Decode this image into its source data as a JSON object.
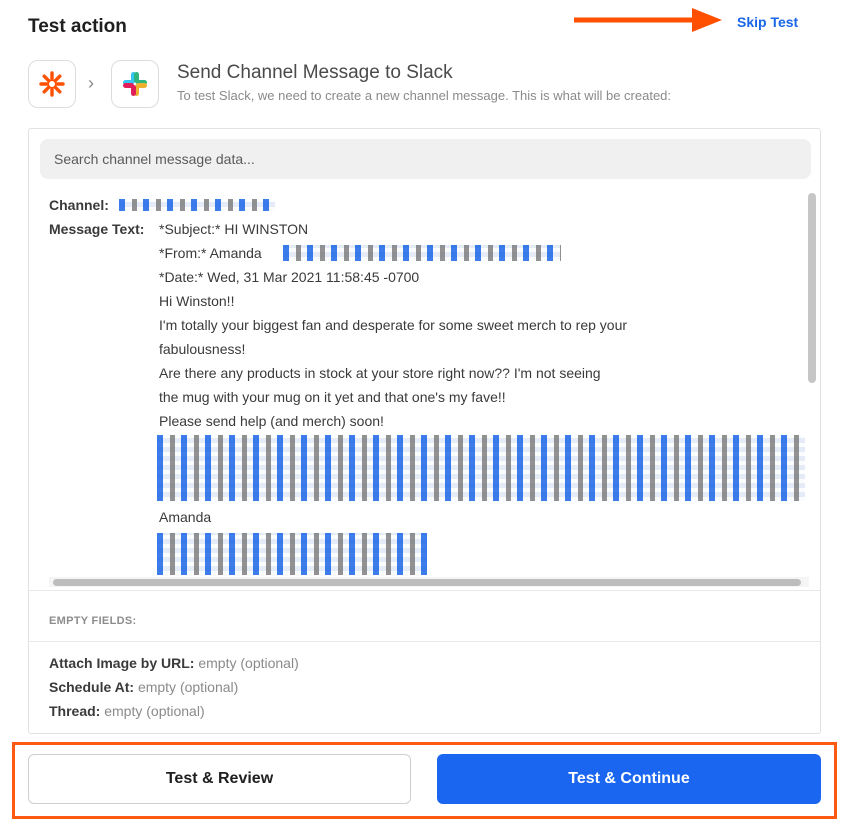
{
  "header": {
    "title": "Test action",
    "skip_label": "Skip Test"
  },
  "step": {
    "title": "Send Channel Message to Slack",
    "subtitle": "To test Slack, we need to create a new channel message. This is what will be created:"
  },
  "search": {
    "placeholder": "Search channel message data..."
  },
  "fields": {
    "channel_key": "Channel:",
    "message_key": "Message Text:",
    "message_lines": [
      "*Subject:* HI WINSTON",
      "*From:* Amanda",
      "*Date:* Wed, 31 Mar 2021 11:58:45 -0700",
      "Hi Winston!!",
      "I'm totally your biggest fan and desperate for some sweet merch to rep your",
      "fabulousness!",
      "Are there any products in stock at your store right now?? I'm not seeing",
      "the mug with your mug on it yet and that one's my fave!!",
      "Please send help (and merch) soon!",
      "Amanda"
    ]
  },
  "empty_fields": {
    "title": "EMPTY FIELDS:",
    "items": [
      {
        "key": "Attach Image by URL:",
        "value": "empty (optional)"
      },
      {
        "key": "Schedule At:",
        "value": "empty (optional)"
      },
      {
        "key": "Thread:",
        "value": "empty (optional)"
      }
    ]
  },
  "buttons": {
    "review": "Test & Review",
    "continue": "Test & Continue"
  },
  "colors": {
    "accent": "#1a66f0",
    "highlight": "#ff5a12",
    "zapier": "#ff4f00"
  },
  "icons": {
    "trigger": "zapier-asterisk-icon",
    "action": "slack-icon",
    "separator": "chevron-right-icon",
    "annotation": "arrow-right-icon"
  }
}
